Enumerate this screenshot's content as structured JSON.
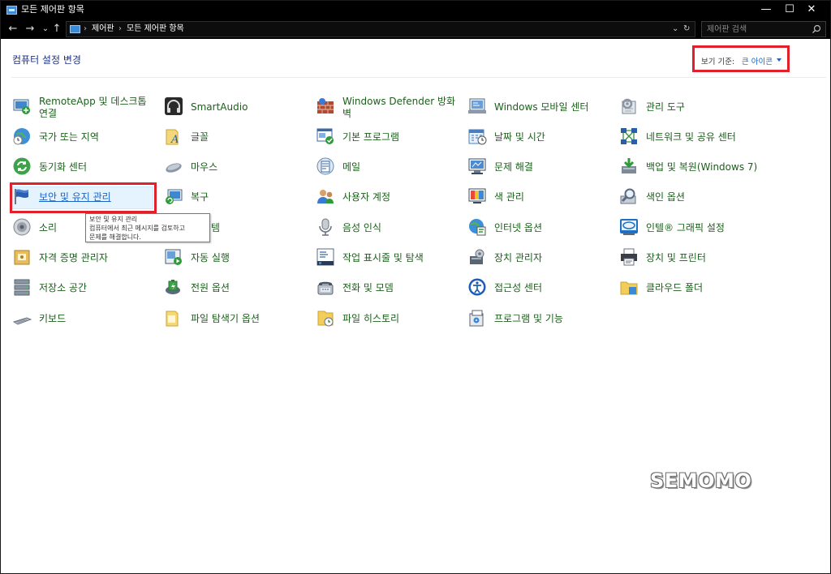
{
  "window": {
    "title": "모든 제어판 항목",
    "controls": {
      "minimize": "—",
      "maximize": "☐",
      "close": "✕"
    }
  },
  "addressbar": {
    "back": "←",
    "forward": "→",
    "history": "⌄",
    "up": "↑",
    "crumbs": [
      "제어판",
      "모든 제어판 항목"
    ],
    "separator": "›",
    "dropdown": "⌄",
    "refresh": "↻",
    "search_placeholder": "제어판 검색"
  },
  "header": {
    "title": "컴퓨터 설정 변경",
    "view_by_label": "보기 기준:",
    "view_by_value": "큰 아이콘"
  },
  "items": [
    {
      "label": "RemoteApp 및 데스크톱",
      "label2": "연결",
      "icon": "remoteapp-icon"
    },
    {
      "label": "SmartAudio",
      "icon": "headphones-icon"
    },
    {
      "label": "Windows Defender 방화",
      "label2": "벽",
      "icon": "firewall-icon"
    },
    {
      "label": "Windows 모바일 센터",
      "icon": "mobility-center-icon"
    },
    {
      "label": "관리 도구",
      "icon": "admin-tools-icon"
    },
    {
      "label": "국가 또는 지역",
      "icon": "region-clock-icon"
    },
    {
      "label": "글꼴",
      "icon": "fonts-icon"
    },
    {
      "label": "기본 프로그램",
      "icon": "default-programs-icon"
    },
    {
      "label": "날짜 및 시간",
      "icon": "date-time-icon"
    },
    {
      "label": "네트워크 및 공유 센터",
      "icon": "network-icon"
    },
    {
      "label": "동기화 센터",
      "icon": "sync-center-icon"
    },
    {
      "label": "마우스",
      "icon": "mouse-icon"
    },
    {
      "label": "메일",
      "icon": "mail-icon"
    },
    {
      "label": "문제 해결",
      "icon": "troubleshoot-icon"
    },
    {
      "label": "백업 및 복원(Windows 7)",
      "icon": "backup-restore-icon"
    },
    {
      "label": "보안 및 유지 관리",
      "icon": "security-flag-icon",
      "selected": true
    },
    {
      "label": "복구",
      "icon": "recovery-icon"
    },
    {
      "label": "사용자 계정",
      "icon": "user-accounts-icon"
    },
    {
      "label": "색 관리",
      "icon": "color-management-icon"
    },
    {
      "label": "색인 옵션",
      "icon": "indexing-icon"
    },
    {
      "label": "소리",
      "icon": "sound-icon"
    },
    {
      "label": "템",
      "icon": "system-icon"
    },
    {
      "label": "음성 인식",
      "icon": "microphone-icon"
    },
    {
      "label": "인터넷 옵션",
      "icon": "internet-options-icon"
    },
    {
      "label": "인텔® 그래픽 설정",
      "icon": "intel-graphics-icon"
    },
    {
      "label": "자격 증명 관리자",
      "icon": "credential-manager-icon"
    },
    {
      "label": "자동 실행",
      "icon": "autoplay-icon"
    },
    {
      "label": "작업 표시줄 및 탐색",
      "icon": "taskbar-icon"
    },
    {
      "label": "장치 관리자",
      "icon": "device-manager-icon"
    },
    {
      "label": "장치 및 프린터",
      "icon": "printer-icon"
    },
    {
      "label": "저장소 공간",
      "icon": "storage-spaces-icon"
    },
    {
      "label": "전원 옵션",
      "icon": "power-options-icon"
    },
    {
      "label": "전화 및 모뎀",
      "icon": "phone-modem-icon"
    },
    {
      "label": "접근성 센터",
      "icon": "ease-of-access-icon"
    },
    {
      "label": "클라우드 폴더",
      "icon": "cloud-folder-icon"
    },
    {
      "label": "키보드",
      "icon": "keyboard-icon"
    },
    {
      "label": "파일 탐색기 옵션",
      "icon": "folder-options-icon"
    },
    {
      "label": "파일 히스토리",
      "icon": "file-history-icon"
    },
    {
      "label": "프로그램 및 기능",
      "icon": "programs-features-icon"
    }
  ],
  "tooltip": {
    "line1": "보안 및 유지 관리",
    "line2": "컴퓨터에서 최근 메시지를 검토하고",
    "line3": "문제를 해결합니다."
  },
  "watermark": "SEMOMO"
}
